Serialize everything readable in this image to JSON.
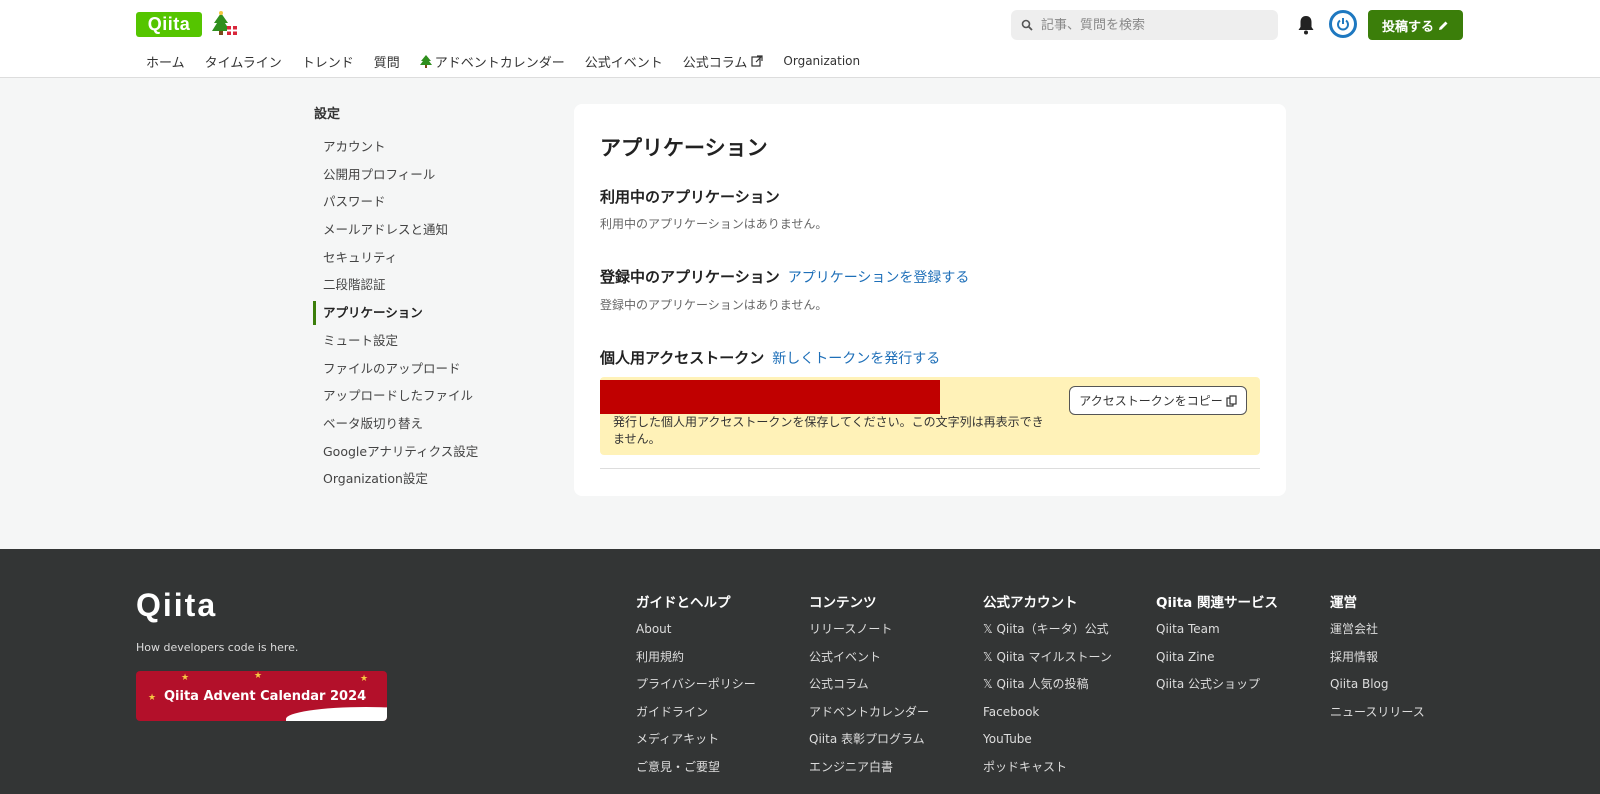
{
  "header": {
    "logo": "Qiita",
    "search_placeholder": "記事、質問を検索",
    "post_button": "投稿する"
  },
  "nav": [
    {
      "label": "ホーム"
    },
    {
      "label": "タイムライン"
    },
    {
      "label": "トレンド"
    },
    {
      "label": "質問"
    },
    {
      "label": "アドベントカレンダー"
    },
    {
      "label": "公式イベント"
    },
    {
      "label": "公式コラム"
    },
    {
      "label": "Organization"
    }
  ],
  "sidebar": {
    "title": "設定",
    "items": [
      {
        "label": "アカウント"
      },
      {
        "label": "公開用プロフィール"
      },
      {
        "label": "パスワード"
      },
      {
        "label": "メールアドレスと通知"
      },
      {
        "label": "セキュリティ"
      },
      {
        "label": "二段階認証"
      },
      {
        "label": "アプリケーション"
      },
      {
        "label": "ミュート設定"
      },
      {
        "label": "ファイルのアップロード"
      },
      {
        "label": "アップロードしたファイル"
      },
      {
        "label": "ベータ版切り替え"
      },
      {
        "label": "Googleアナリティクス設定"
      },
      {
        "label": "Organization設定"
      }
    ],
    "active": "アプリケーション"
  },
  "main": {
    "title": "アプリケーション",
    "in_use": {
      "heading": "利用中のアプリケーション",
      "empty": "利用中のアプリケーションはありません。"
    },
    "registered": {
      "heading": "登録中のアプリケーション",
      "link": "アプリケーションを登録する",
      "empty": "登録中のアプリケーションはありません。"
    },
    "token": {
      "heading": "個人用アクセストークン",
      "link": "新しくトークンを発行する",
      "note": "発行した個人用アクセストークンを保存してください。この文字列は再表示できません。",
      "copy_button": "アクセストークンをコピー"
    }
  },
  "footer": {
    "logo": "Qiita",
    "tagline": "How developers code is here.",
    "advent_banner": "Qiita Advent Calendar 2024",
    "columns": [
      {
        "title": "ガイドとヘルプ",
        "links": [
          "About",
          "利用規約",
          "プライバシーポリシー",
          "ガイドライン",
          "メディアキット",
          "ご意見・ご要望"
        ]
      },
      {
        "title": "コンテンツ",
        "links": [
          "リリースノート",
          "公式イベント",
          "公式コラム",
          "アドベントカレンダー",
          "Qiita 表彰プログラム",
          "エンジニア白書"
        ]
      },
      {
        "title": "公式アカウント",
        "links": [
          "𝕏 Qiita（キータ）公式",
          "𝕏 Qiita マイルストーン",
          "𝕏 Qiita 人気の投稿",
          "Facebook",
          "YouTube",
          "ポッドキャスト"
        ]
      },
      {
        "title": "Qiita 関連サービス",
        "links": [
          "Qiita Team",
          "Qiita Zine",
          "Qiita 公式ショップ"
        ]
      },
      {
        "title": "運営",
        "links": [
          "運営会社",
          "採用情報",
          "Qiita Blog",
          "ニュースリリース"
        ]
      }
    ]
  },
  "colors": {
    "brand_green": "#55c500",
    "post_button": "#3b7e0a",
    "link_blue": "#1e6fb8",
    "token_bg": "#fff2b8",
    "redaction": "#c00000",
    "footer_bg": "#333535"
  }
}
